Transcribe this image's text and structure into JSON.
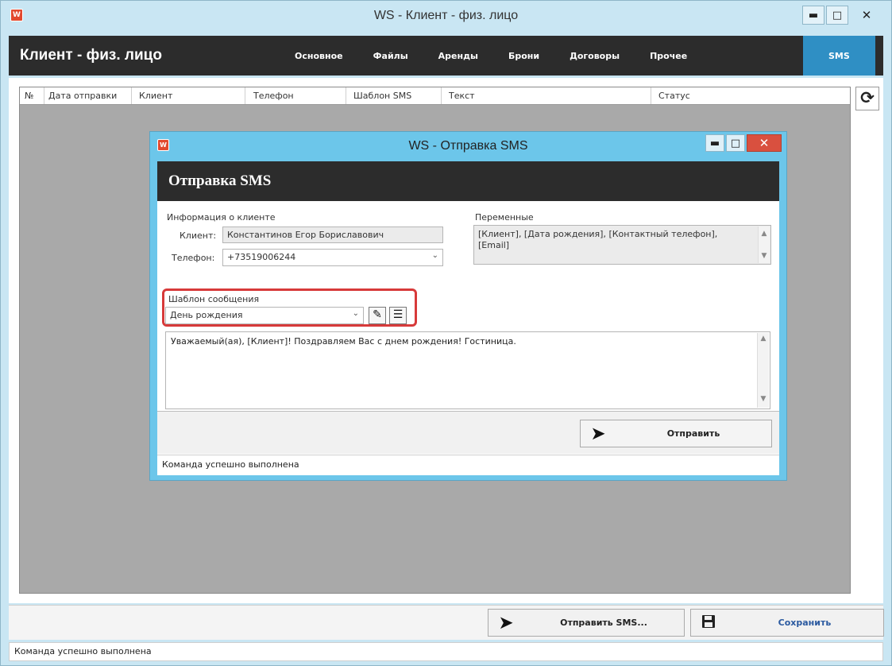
{
  "main_window": {
    "title": "WS - Клиент - физ. лицо",
    "icon_letter": "W",
    "controls": [
      "minimize",
      "maximize",
      "close"
    ]
  },
  "header": {
    "title": "Клиент - физ. лицо",
    "tabs": [
      {
        "label": "Основное",
        "active": false
      },
      {
        "label": "Файлы",
        "active": false
      },
      {
        "label": "Аренды",
        "active": false
      },
      {
        "label": "Брони",
        "active": false
      },
      {
        "label": "Договоры",
        "active": false
      },
      {
        "label": "Прочее",
        "active": false
      },
      {
        "label": "SMS",
        "active": true
      }
    ]
  },
  "table": {
    "columns": [
      "№",
      "Дата отправки",
      "Клиент",
      "Телефон",
      "Шаблон SMS",
      "Текст",
      "Статус"
    ],
    "rows": []
  },
  "toolbar": {
    "refresh_icon": "refresh-icon",
    "send_sms_label": "Отправить SMS...",
    "save_label": "Сохранить"
  },
  "status_bar": {
    "text": "Команда успешно выполнена"
  },
  "sms_dialog": {
    "window_title": "WS - Отправка SMS",
    "icon_letter": "W",
    "header_title": "Отправка SMS",
    "client_group_label": "Информация о клиенте",
    "client_label": "Клиент:",
    "client_value": "Константинов Егор Бориславович",
    "phone_label": "Телефон:",
    "phone_value": "+73519006244",
    "variables_label": "Переменные",
    "variables_text": "[Клиент], [Дата рождения], [Контактный телефон], [Email]",
    "template_label": "Шаблон сообщения",
    "template_value": "День рождения",
    "message_text": "Уважаемый(ая), [Клиент]! Поздравляем Вас с днем рождения! Гостиница.",
    "send_label": "Отправить",
    "status_text": "Команда успешно выполнена"
  },
  "colors": {
    "window_chrome": "#c9e6f3",
    "dialog_chrome": "#6cc6ea",
    "header_dark": "#2c2c2c",
    "active_tab": "#2f8fc4",
    "grid_background": "#a9a9a9",
    "highlight": "#d73a3a",
    "close_button": "#d9503f"
  }
}
